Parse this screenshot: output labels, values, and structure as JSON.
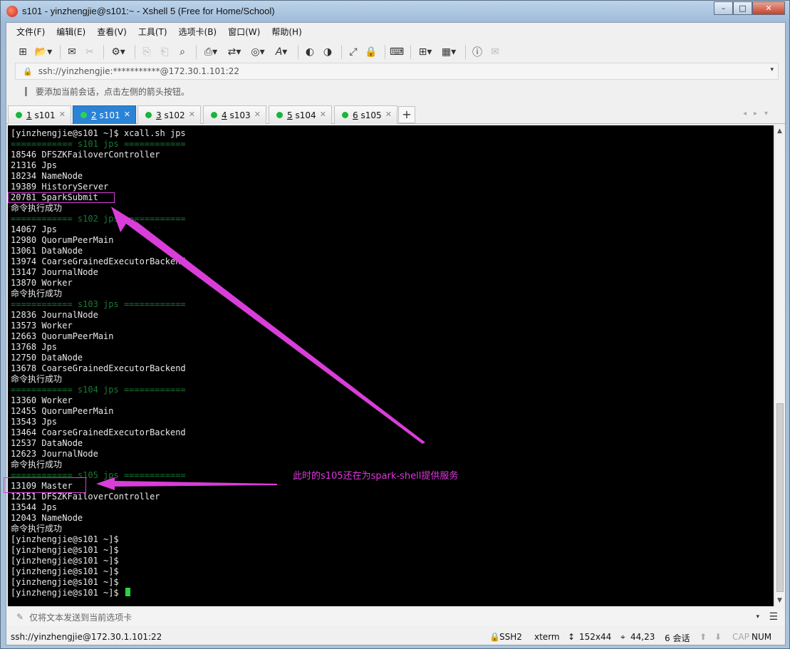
{
  "window": {
    "title": "s101 - yinzhengjie@s101:~ - Xshell 5 (Free for Home/School)",
    "controls": [
      "–",
      "□",
      "✕"
    ]
  },
  "menu": {
    "items": [
      "文件(F)",
      "编辑(E)",
      "查看(V)",
      "工具(T)",
      "选项卡(B)",
      "窗口(W)",
      "帮助(H)"
    ]
  },
  "address": {
    "value": "ssh://yinzhengjie:***********@172.30.1.101:22"
  },
  "hint": {
    "text": "要添加当前会话，点击左侧的箭头按钮。"
  },
  "tabs": [
    {
      "num": "1",
      "name": " s101",
      "active": false
    },
    {
      "num": "2",
      "name": " s101",
      "active": true
    },
    {
      "num": "3",
      "name": " s102",
      "active": false
    },
    {
      "num": "4",
      "name": " s103",
      "active": false
    },
    {
      "num": "5",
      "name": " s104",
      "active": false
    },
    {
      "num": "6",
      "name": " s105",
      "active": false
    }
  ],
  "terminal": {
    "lines": [
      {
        "t": "[yinzhengjie@s101 ~]$ xcall.sh jps",
        "sep": false
      },
      {
        "t": "============ s101 jps ============",
        "sep": true
      },
      {
        "t": "18546 DFSZKFailoverController",
        "sep": false
      },
      {
        "t": "21316 Jps",
        "sep": false
      },
      {
        "t": "18234 NameNode",
        "sep": false
      },
      {
        "t": "19389 HistoryServer",
        "sep": false
      },
      {
        "t": "20781 SparkSubmit",
        "sep": false
      },
      {
        "t": "命令执行成功",
        "sep": false
      },
      {
        "t": "============ s102 jps ============",
        "sep": true
      },
      {
        "t": "14067 Jps",
        "sep": false
      },
      {
        "t": "12980 QuorumPeerMain",
        "sep": false
      },
      {
        "t": "13061 DataNode",
        "sep": false
      },
      {
        "t": "13974 CoarseGrainedExecutorBackend",
        "sep": false
      },
      {
        "t": "13147 JournalNode",
        "sep": false
      },
      {
        "t": "13870 Worker",
        "sep": false
      },
      {
        "t": "命令执行成功",
        "sep": false
      },
      {
        "t": "============ s103 jps ============",
        "sep": true
      },
      {
        "t": "12836 JournalNode",
        "sep": false
      },
      {
        "t": "13573 Worker",
        "sep": false
      },
      {
        "t": "12663 QuorumPeerMain",
        "sep": false
      },
      {
        "t": "13768 Jps",
        "sep": false
      },
      {
        "t": "12750 DataNode",
        "sep": false
      },
      {
        "t": "13678 CoarseGrainedExecutorBackend",
        "sep": false
      },
      {
        "t": "命令执行成功",
        "sep": false
      },
      {
        "t": "============ s104 jps ============",
        "sep": true
      },
      {
        "t": "13360 Worker",
        "sep": false
      },
      {
        "t": "12455 QuorumPeerMain",
        "sep": false
      },
      {
        "t": "13543 Jps",
        "sep": false
      },
      {
        "t": "13464 CoarseGrainedExecutorBackend",
        "sep": false
      },
      {
        "t": "12537 DataNode",
        "sep": false
      },
      {
        "t": "12623 JournalNode",
        "sep": false
      },
      {
        "t": "命令执行成功",
        "sep": false
      },
      {
        "t": "============ s105 jps ============",
        "sep": true
      },
      {
        "t": "13109 Master",
        "sep": false
      },
      {
        "t": "12151 DFSZKFailoverController",
        "sep": false
      },
      {
        "t": "13544 Jps",
        "sep": false
      },
      {
        "t": "12043 NameNode",
        "sep": false
      },
      {
        "t": "命令执行成功",
        "sep": false
      },
      {
        "t": "[yinzhengjie@s101 ~]$",
        "sep": false
      },
      {
        "t": "[yinzhengjie@s101 ~]$",
        "sep": false
      },
      {
        "t": "[yinzhengjie@s101 ~]$",
        "sep": false
      },
      {
        "t": "[yinzhengjie@s101 ~]$",
        "sep": false
      },
      {
        "t": "[yinzhengjie@s101 ~]$",
        "sep": false
      },
      {
        "t": "[yinzhengjie@s101 ~]$ ",
        "sep": false,
        "cursor": true
      }
    ]
  },
  "annotation": {
    "text": "此时的s105还在为spark-shell提供服务",
    "color": "#e036e0"
  },
  "send": {
    "placeholder": "仅将文本发送到当前选项卡"
  },
  "status": {
    "connection": "ssh://yinzhengjie@172.30.1.101:22",
    "protocol": "SSH2",
    "term": "xterm",
    "size": "152x44",
    "position": "44,23",
    "sessions": "6 会话",
    "caps": "CAP",
    "num": "NUM"
  },
  "colors": {
    "tab_active": "#2b83d6",
    "terminal_bg": "#000000",
    "separator": "#1a7a33",
    "cursor": "#2bd14a",
    "annotation": "#e036e0"
  }
}
